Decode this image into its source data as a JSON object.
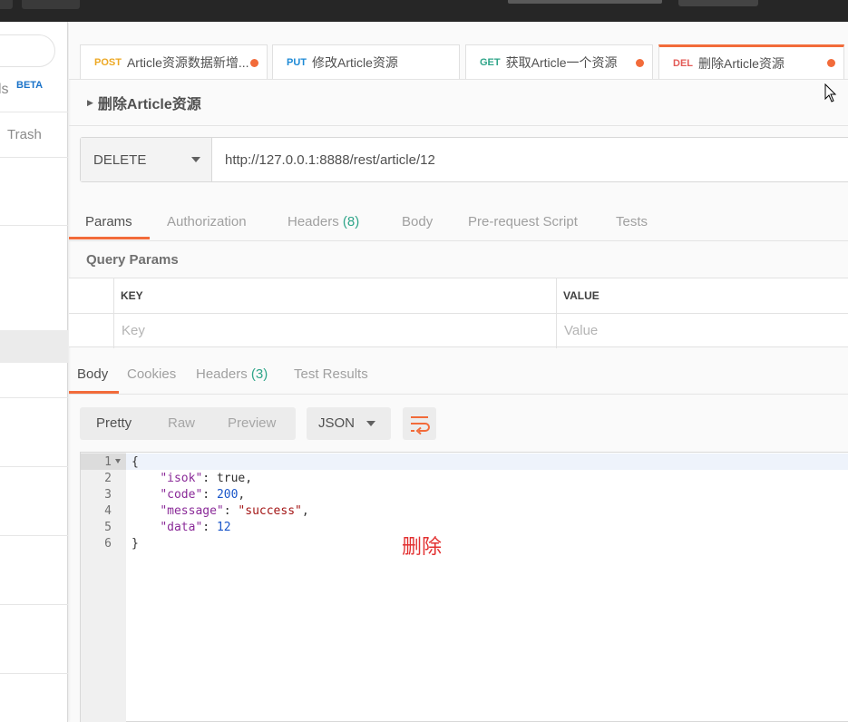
{
  "sidebar": {
    "tools_fragment": "ls",
    "beta_badge": "BETA",
    "trash_label": "Trash"
  },
  "tabs": [
    {
      "method": "POST",
      "name": "Article资源数据新增...",
      "unsaved": true
    },
    {
      "method": "PUT",
      "name": "修改Article资源",
      "unsaved": false
    },
    {
      "method": "GET",
      "name": "获取Article一个资源",
      "unsaved": true
    },
    {
      "method": "DEL",
      "name": "删除Article资源",
      "unsaved": true,
      "active": true
    }
  ],
  "request": {
    "title": "删除Article资源",
    "method": "DELETE",
    "url": "http://127.0.0.1:8888/rest/article/12"
  },
  "request_tabs": {
    "params": "Params",
    "authorization": "Authorization",
    "headers": "Headers",
    "headers_count": "(8)",
    "body": "Body",
    "prerequest": "Pre-request Script",
    "tests": "Tests"
  },
  "query_params": {
    "label": "Query Params",
    "key_header": "KEY",
    "value_header": "VALUE",
    "key_placeholder": "Key",
    "value_placeholder": "Value"
  },
  "response_tabs": {
    "body": "Body",
    "cookies": "Cookies",
    "headers": "Headers",
    "headers_count": "(3)",
    "test_results": "Test Results"
  },
  "response_toolbar": {
    "pretty": "Pretty",
    "raw": "Raw",
    "preview": "Preview",
    "format": "JSON"
  },
  "response_body": {
    "line_numbers": [
      "1",
      "2",
      "3",
      "4",
      "5",
      "6"
    ],
    "open_brace": "{",
    "close_brace": "}",
    "fields": [
      {
        "key": "\"isok\"",
        "value": "true",
        "sep": ","
      },
      {
        "key": "\"code\"",
        "value": "200",
        "sep": ","
      },
      {
        "key": "\"message\"",
        "value": "\"success\"",
        "sep": ","
      },
      {
        "key": "\"data\"",
        "value": "12",
        "sep": ""
      }
    ]
  },
  "annotation": "删除",
  "colors": {
    "accent": "#f26b3a",
    "post": "#eda823",
    "put": "#1e8ad6",
    "get": "#2fa589",
    "del": "#e35b57"
  }
}
